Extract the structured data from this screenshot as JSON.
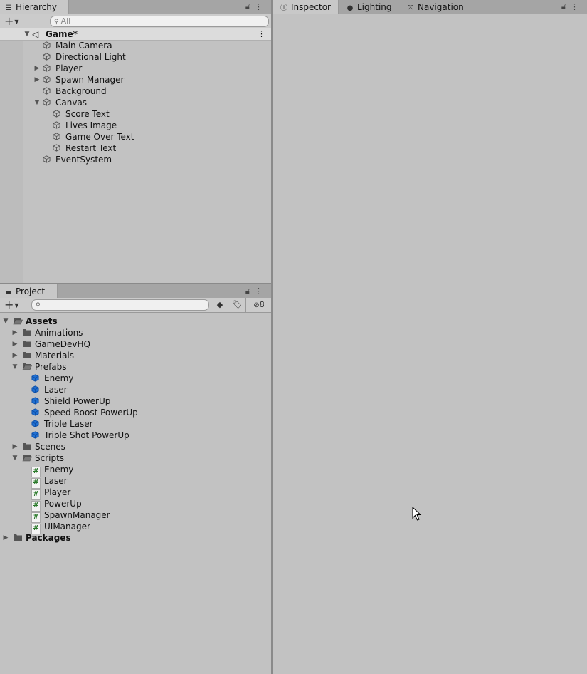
{
  "hierarchy": {
    "tab_label": "Hierarchy",
    "search_placeholder": "All",
    "scene_label": "Game*",
    "items": [
      {
        "label": "Main Camera",
        "depth": 1,
        "expander": "none"
      },
      {
        "label": "Directional Light",
        "depth": 1,
        "expander": "none"
      },
      {
        "label": "Player",
        "depth": 1,
        "expander": "collapsed"
      },
      {
        "label": "Spawn Manager",
        "depth": 1,
        "expander": "collapsed"
      },
      {
        "label": "Background",
        "depth": 1,
        "expander": "none"
      },
      {
        "label": "Canvas",
        "depth": 1,
        "expander": "expanded"
      },
      {
        "label": "Score Text",
        "depth": 2,
        "expander": "none"
      },
      {
        "label": "Lives Image",
        "depth": 2,
        "expander": "none"
      },
      {
        "label": "Game Over Text",
        "depth": 2,
        "expander": "none"
      },
      {
        "label": "Restart Text",
        "depth": 2,
        "expander": "none"
      },
      {
        "label": "EventSystem",
        "depth": 1,
        "expander": "none"
      }
    ]
  },
  "project": {
    "tab_label": "Project",
    "search_placeholder": "",
    "hidden_count": "8",
    "items": [
      {
        "label": "Assets",
        "depth": 0,
        "type": "folder-open",
        "expander": "expanded",
        "bold": true
      },
      {
        "label": "Animations",
        "depth": 1,
        "type": "folder",
        "expander": "collapsed"
      },
      {
        "label": "GameDevHQ",
        "depth": 1,
        "type": "folder",
        "expander": "collapsed"
      },
      {
        "label": "Materials",
        "depth": 1,
        "type": "folder",
        "expander": "collapsed"
      },
      {
        "label": "Prefabs",
        "depth": 1,
        "type": "folder-open",
        "expander": "expanded"
      },
      {
        "label": "Enemy",
        "depth": 2,
        "type": "prefab",
        "expander": "none"
      },
      {
        "label": "Laser",
        "depth": 2,
        "type": "prefab",
        "expander": "none"
      },
      {
        "label": "Shield PowerUp",
        "depth": 2,
        "type": "prefab",
        "expander": "none"
      },
      {
        "label": "Speed Boost PowerUp",
        "depth": 2,
        "type": "prefab",
        "expander": "none"
      },
      {
        "label": "Triple Laser",
        "depth": 2,
        "type": "prefab",
        "expander": "none"
      },
      {
        "label": "Triple Shot PowerUp",
        "depth": 2,
        "type": "prefab",
        "expander": "none"
      },
      {
        "label": "Scenes",
        "depth": 1,
        "type": "folder",
        "expander": "collapsed"
      },
      {
        "label": "Scripts",
        "depth": 1,
        "type": "folder-open",
        "expander": "expanded"
      },
      {
        "label": "Enemy",
        "depth": 2,
        "type": "script",
        "expander": "none"
      },
      {
        "label": "Laser",
        "depth": 2,
        "type": "script",
        "expander": "none"
      },
      {
        "label": "Player",
        "depth": 2,
        "type": "script",
        "expander": "none"
      },
      {
        "label": "PowerUp",
        "depth": 2,
        "type": "script",
        "expander": "none"
      },
      {
        "label": "SpawnManager",
        "depth": 2,
        "type": "script",
        "expander": "none"
      },
      {
        "label": "UIManager",
        "depth": 2,
        "type": "script",
        "expander": "none"
      },
      {
        "label": "Packages",
        "depth": 0,
        "type": "folder",
        "expander": "collapsed",
        "bold": true
      }
    ]
  },
  "inspector": {
    "tabs": [
      {
        "label": "Inspector",
        "icon": "info-icon",
        "active": true
      },
      {
        "label": "Lighting",
        "icon": "lightbulb-icon",
        "active": false
      },
      {
        "label": "Navigation",
        "icon": "navigation-icon",
        "active": false
      }
    ]
  },
  "colors": {
    "panel_bg": "#c2c2c2",
    "tab_bar": "#a5a5a5",
    "prefab_blue": "#1f6fd1",
    "script_green": "#2a7a2a"
  }
}
